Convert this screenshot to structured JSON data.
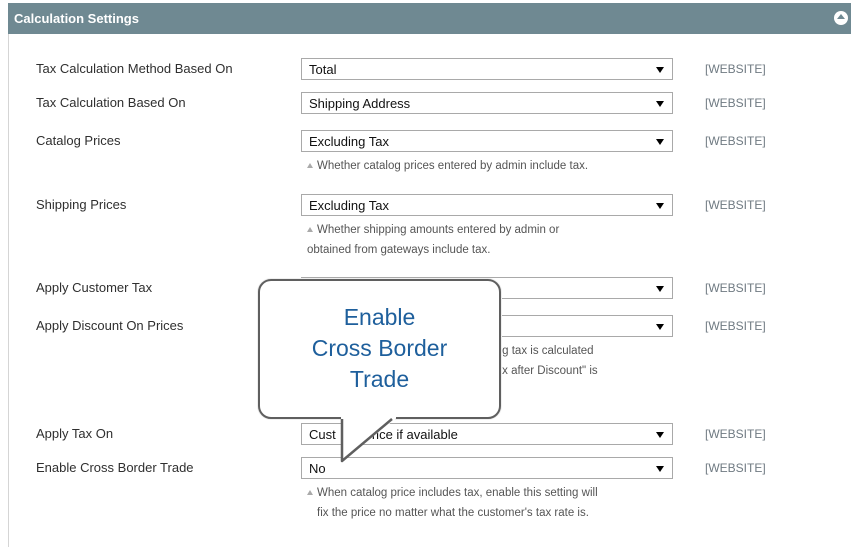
{
  "panel": {
    "title": "Calculation Settings"
  },
  "settings": [
    {
      "label": "Tax Calculation Method Based On",
      "value": "Total",
      "scope": "[WEBSITE]"
    },
    {
      "label": "Tax Calculation Based On",
      "value": "Shipping Address",
      "scope": "[WEBSITE]"
    },
    {
      "label": "Catalog Prices",
      "value": "Excluding Tax",
      "scope": "[WEBSITE]",
      "note_lines": [
        "Whether catalog prices entered by admin include tax."
      ]
    },
    {
      "label": "Shipping Prices",
      "value": "Excluding Tax",
      "scope": "[WEBSITE]",
      "note_lines": [
        "Whether shipping amounts entered by admin or",
        "obtained from gateways include tax."
      ]
    },
    {
      "label": "Apply Customer Tax",
      "value": "",
      "scope": "[WEBSITE]"
    },
    {
      "label": "Apply Discount On Prices",
      "value": "",
      "scope": "[WEBSITE]",
      "note_fragments": [
        "ting tax is calculated",
        "Tax after Discount\" is"
      ]
    },
    {
      "label": "Apply Tax On",
      "value": "Custom price if available",
      "value_visible": "Cust          rice if available",
      "scope": "[WEBSITE]"
    },
    {
      "label": "Enable Cross Border Trade",
      "value": "No",
      "scope": "[WEBSITE]",
      "note_lines": [
        "When catalog price includes tax, enable this setting will",
        "fix the price no matter what the customer's tax rate is."
      ]
    }
  ],
  "callout": {
    "lines": [
      "Enable",
      "Cross Border",
      "Trade"
    ],
    "text_color": "#1e5f9c"
  },
  "colors": {
    "header_bg": "#6f8992",
    "scope_text": "#6f7a82"
  }
}
